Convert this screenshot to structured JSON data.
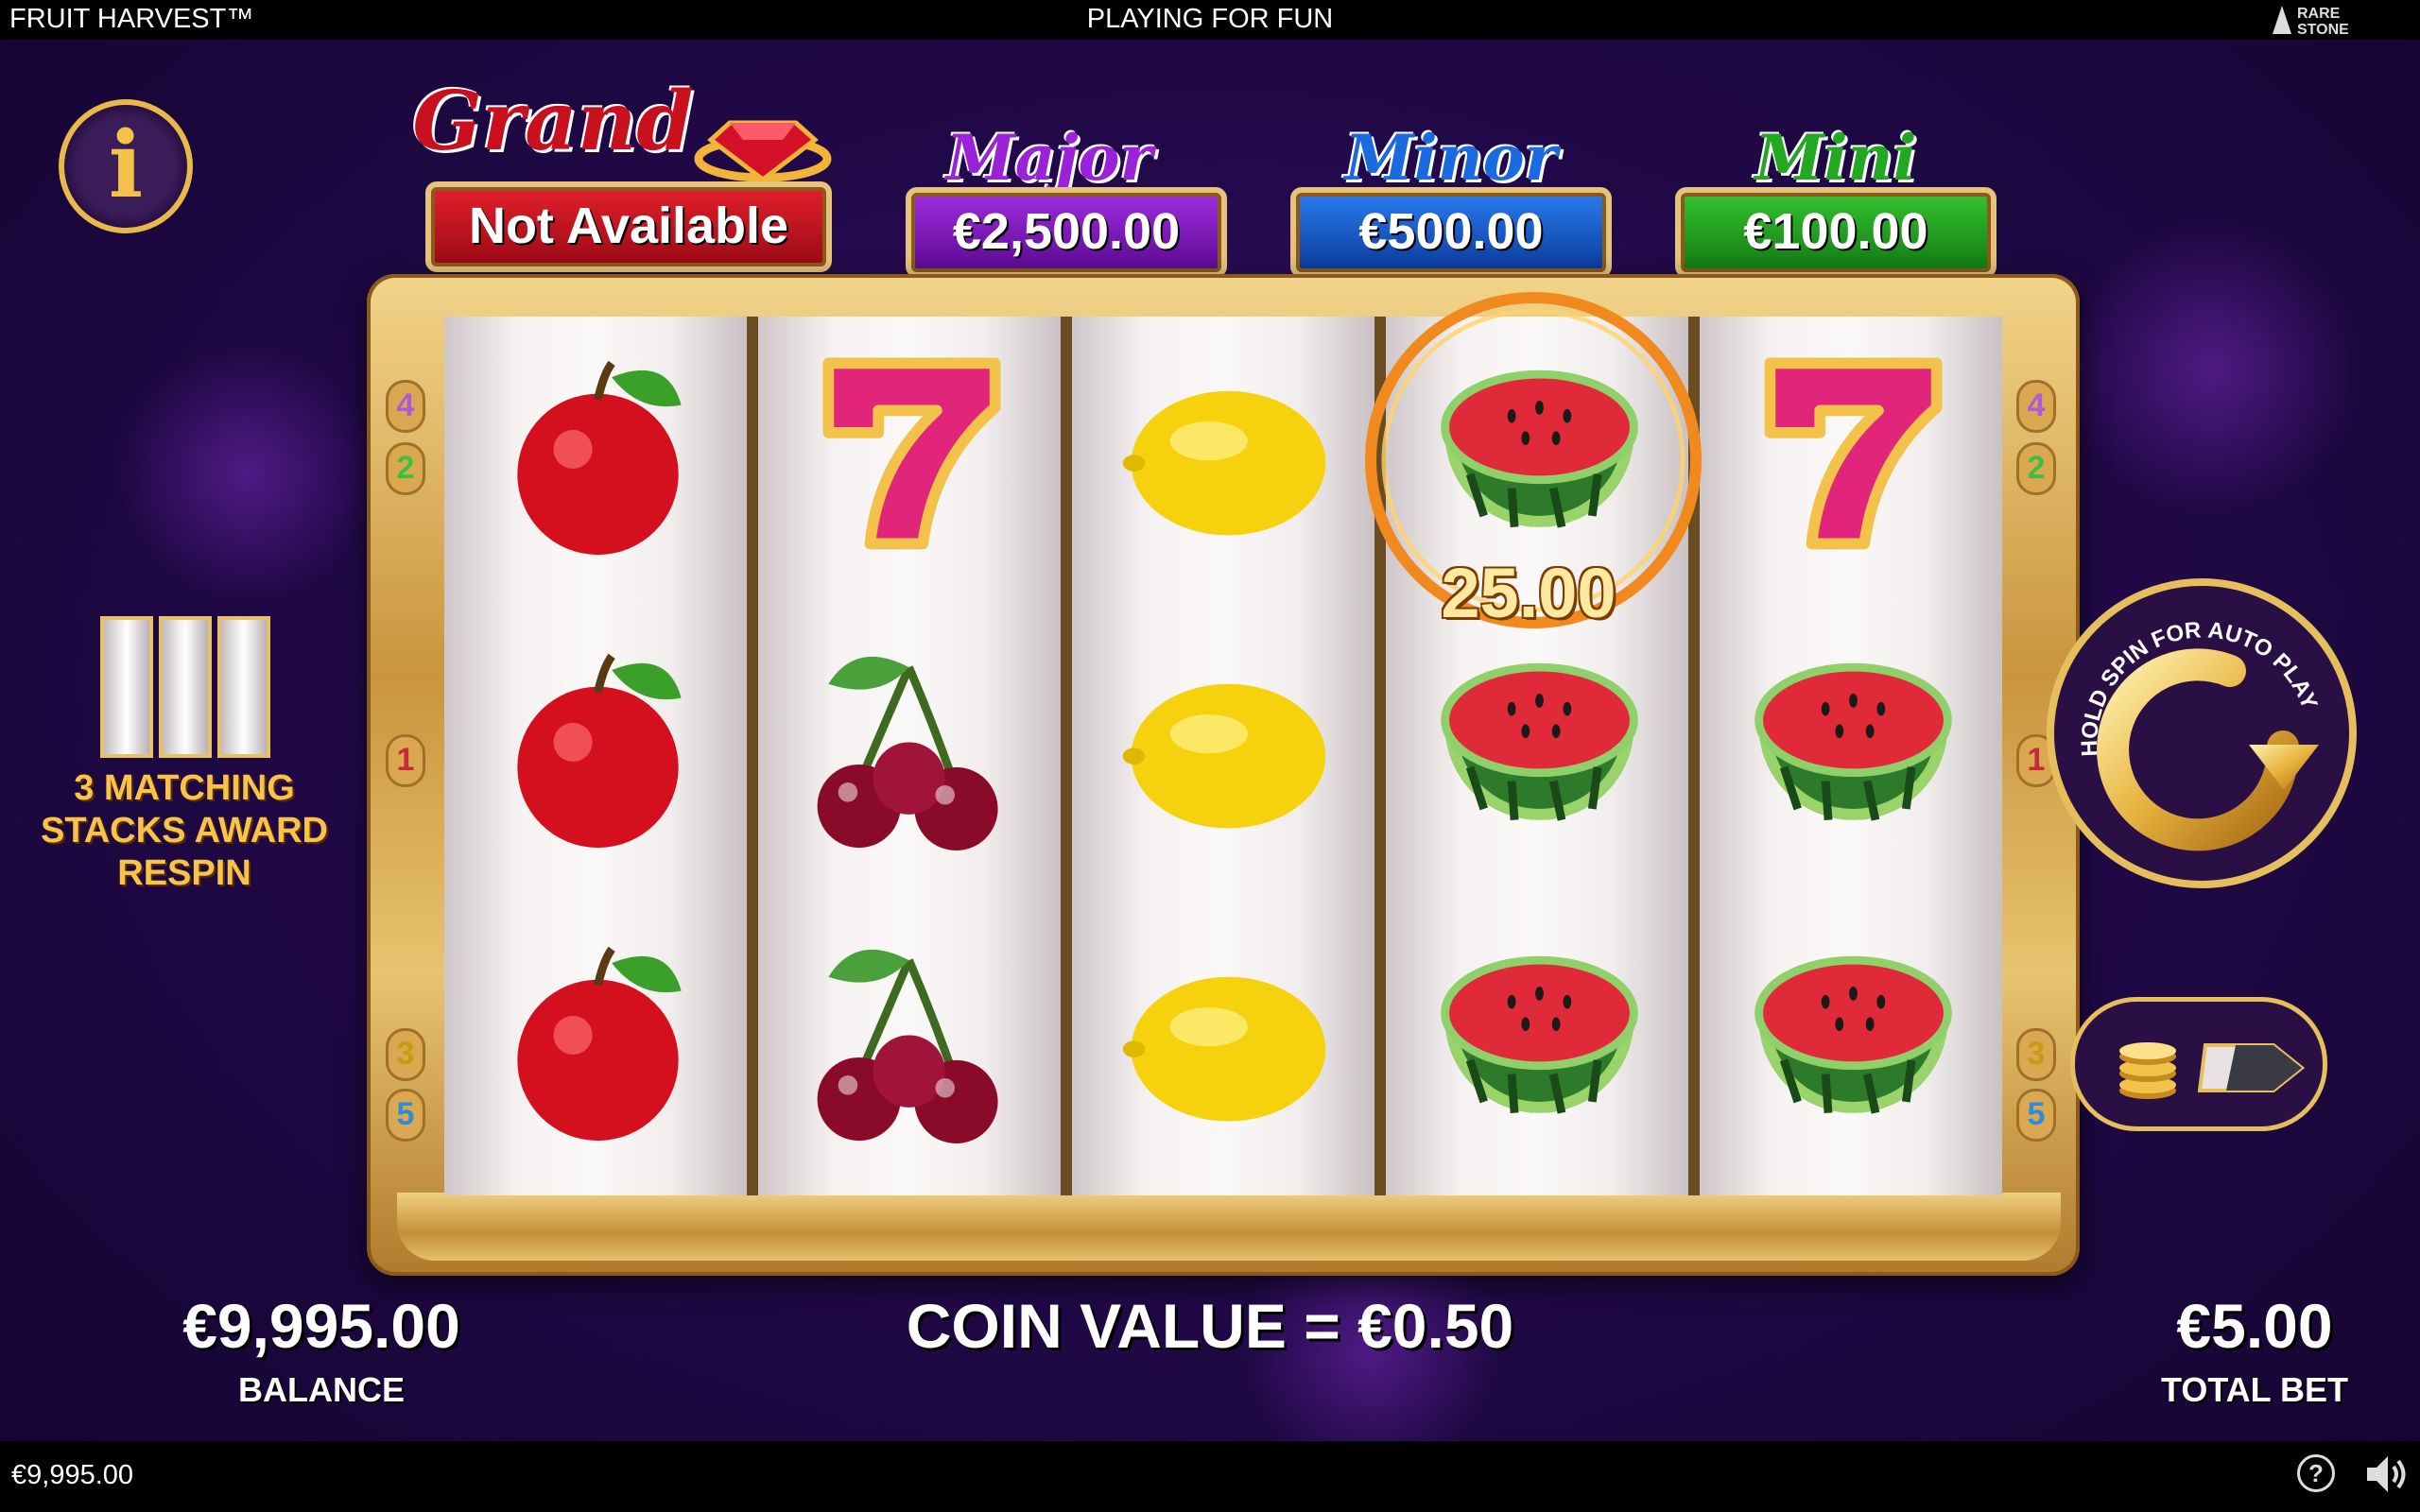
{
  "top_bar": {
    "title": "FRUIT HARVEST™",
    "mode": "PLAYING FOR FUN",
    "logo": "RARE STONE"
  },
  "jackpots": [
    {
      "label": "Grand",
      "value": "Not Available",
      "color": "#c8101e"
    },
    {
      "label": "Major",
      "value": "€2,500.00",
      "color": "#8a18c8"
    },
    {
      "label": "Minor",
      "value": "€500.00",
      "color": "#1565d8"
    },
    {
      "label": "Mini",
      "value": "€100.00",
      "color": "#23a822"
    }
  ],
  "reels": [
    [
      "apple",
      "apple",
      "apple"
    ],
    [
      "seven",
      "cherries",
      "cherries"
    ],
    [
      "lemon",
      "lemon",
      "lemon"
    ],
    [
      "watermelon",
      "watermelon",
      "watermelon"
    ],
    [
      "seven",
      "watermelon",
      "watermelon"
    ]
  ],
  "paylines": {
    "left": [
      "4",
      "2",
      "1",
      "3",
      "5"
    ],
    "right": [
      "4",
      "2",
      "1",
      "3",
      "5"
    ]
  },
  "win_amount": "25.00",
  "respin_hint": [
    "3 MATCHING",
    "STACKS AWARD",
    "RESPIN"
  ],
  "spin_button": {
    "text": "HOLD SPIN FOR AUTO PLAY"
  },
  "balance": {
    "value": "€9,995.00",
    "label": "BALANCE"
  },
  "coin_value": "COIN VALUE = €0.50",
  "total_bet": {
    "value": "€5.00",
    "label": "TOTAL BET"
  },
  "bottom_bar": {
    "balance": "€9,995.00"
  }
}
